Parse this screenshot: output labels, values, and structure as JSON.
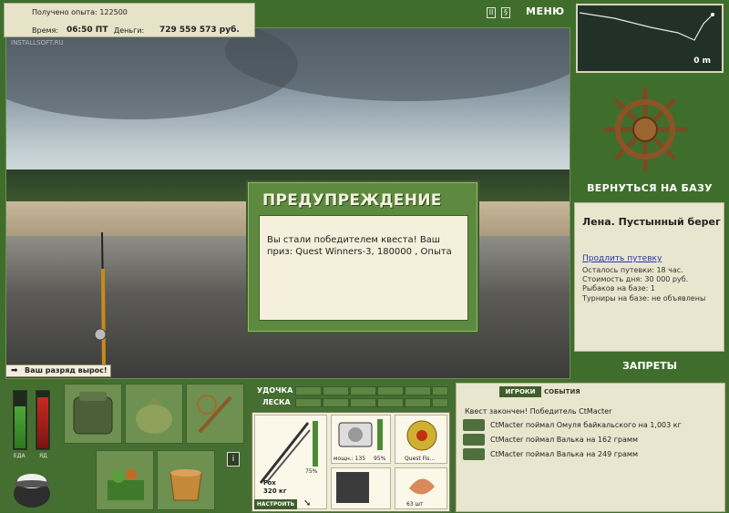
{
  "header": {
    "xp_label": "Получено опыта:",
    "xp_value": "122500",
    "time_label": "Время:",
    "time_value": "06:50 ПТ",
    "money_label": "Деньги:",
    "money_value": "729 559 573 руб.",
    "watermark": "INSTALLSOFT.RU",
    "menu_label": "МЕНЮ"
  },
  "depth_map": {
    "depth_value": "0 m"
  },
  "scene": {
    "rank_notice": "Ваш разряд вырос!"
  },
  "dialog": {
    "title": "ПРЕДУПРЕЖДЕНИЕ",
    "message": "Вы стали победителем квеста! Ваш приз: Quest Winners-3, 180000 , Опыта"
  },
  "location": {
    "return_label": "ВЕРНУТЬСЯ НА БАЗУ",
    "name": "Лена. Пустынный берег",
    "extend_link": "Продлить путевку",
    "remaining": "Осталось путевки: 18 час.",
    "cost": "Стоимость дня: 30 000 руб.",
    "anglers": "Рыбаков на базе: 1",
    "tournaments": "Турниры на базе: не объявлены",
    "bans_label": "ЗАПРЕТЫ"
  },
  "status": {
    "food_label": "ЕДА",
    "poison_label": "ЯД",
    "food_level": 0.75,
    "poison_level": 0.9
  },
  "tackle": {
    "rod_label": "УДОЧКА",
    "line_label": "ЛЕСКА",
    "rod_name": "Fox",
    "rod_weight": "320 кг",
    "rod_percent": "75%",
    "reel_power": "мощн.: 135",
    "reel_percent": "95%",
    "line_name": "Quest Fis...",
    "bait_count": "63 шт",
    "setup_label": "НАСТРОИТЬ"
  },
  "events": {
    "tab_players": "ИГРОКИ",
    "tab_events": "СОБЫТИЯ",
    "items": [
      "Квест закончен! Победитель CtMacter",
      "CtMacter поймал Омуля байкальского на 1,003 кг",
      "CtMacter поймал Валька на 162 грамм",
      "CtMacter поймал Валька на 249 грамм"
    ]
  }
}
